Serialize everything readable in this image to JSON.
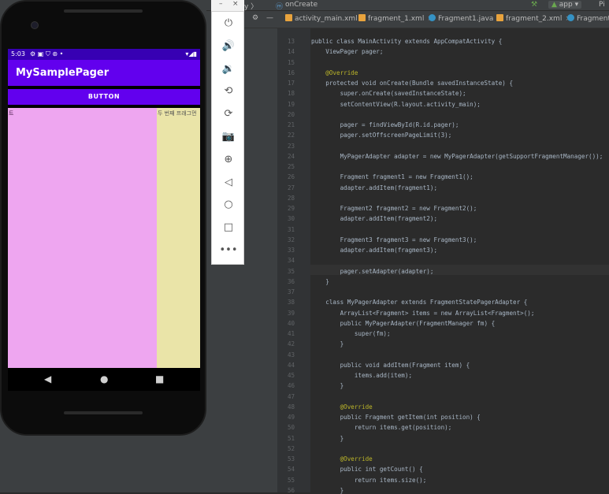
{
  "ide": {
    "breadcrumb_sep": "y 〉",
    "breadcrumb_method": "onCreate",
    "run_config": "app",
    "run_config_extra": "Pi",
    "tabs": [
      {
        "label": "activity_main.xml",
        "color": "#e8a33d"
      },
      {
        "label": "fragment_1.xml",
        "color": "#e8a33d"
      },
      {
        "label": "Fragment1.java",
        "color": "#3592c4"
      },
      {
        "label": "fragment_2.xml",
        "color": "#e8a33d"
      },
      {
        "label": "Fragment2.j",
        "color": "#3592c4"
      }
    ],
    "tab_close": "×"
  },
  "emulator_toolbar": {
    "minimize": "–",
    "close": "×",
    "icons": [
      "power-icon",
      "volume-up-icon",
      "volume-down-icon",
      "rotate-left-icon",
      "rotate-right-icon",
      "camera-icon",
      "zoom-icon",
      "back-icon",
      "home-icon",
      "overview-icon",
      "more-icon"
    ],
    "glyphs": [
      "⏻",
      "🔊",
      "🔉",
      "⟲",
      "⟳",
      "📷",
      "⊕",
      "◁",
      "○",
      "□",
      "•••"
    ]
  },
  "phone": {
    "time": "5:03",
    "status_icons": "⚙ ▣ ⛉ ⊛ •",
    "right_icons": "▾◢▮",
    "app_title": "MySamplePager",
    "button_label": "BUTTON",
    "page1_text": "트",
    "page2_text": "두 번째 프래그먼",
    "nav_back": "◀",
    "nav_home": "●",
    "nav_recent": "■"
  },
  "code_lines": [
    {
      "n": "13",
      "t": "public class MainActivity extends AppCompatActivity {"
    },
    {
      "n": "14",
      "t": "    ViewPager pager;"
    },
    {
      "n": "15",
      "t": ""
    },
    {
      "n": "16",
      "t": "    @Override"
    },
    {
      "n": "17",
      "t": "    protected void onCreate(Bundle savedInstanceState) {"
    },
    {
      "n": "18",
      "t": "        super.onCreate(savedInstanceState);"
    },
    {
      "n": "19",
      "t": "        setContentView(R.layout.activity_main);"
    },
    {
      "n": "20",
      "t": ""
    },
    {
      "n": "21",
      "t": "        pager = findViewById(R.id.pager);"
    },
    {
      "n": "22",
      "t": "        pager.setOffscreenPageLimit(3);"
    },
    {
      "n": "23",
      "t": ""
    },
    {
      "n": "24",
      "t": "        MyPagerAdapter adapter = new MyPagerAdapter(getSupportFragmentManager());"
    },
    {
      "n": "25",
      "t": ""
    },
    {
      "n": "26",
      "t": "        Fragment fragment1 = new Fragment1();"
    },
    {
      "n": "27",
      "t": "        adapter.addItem(fragment1);"
    },
    {
      "n": "28",
      "t": ""
    },
    {
      "n": "29",
      "t": "        Fragment2 fragment2 = new Fragment2();"
    },
    {
      "n": "30",
      "t": "        adapter.addItem(fragment2);"
    },
    {
      "n": "31",
      "t": ""
    },
    {
      "n": "32",
      "t": "        Fragment3 fragment3 = new Fragment3();"
    },
    {
      "n": "33",
      "t": "        adapter.addItem(fragment3);"
    },
    {
      "n": "34",
      "t": ""
    },
    {
      "n": "35",
      "t": "        pager.setAdapter(adapter);"
    },
    {
      "n": "36",
      "t": "    }"
    },
    {
      "n": "37",
      "t": ""
    },
    {
      "n": "38",
      "t": "    class MyPagerAdapter extends FragmentStatePagerAdapter {"
    },
    {
      "n": "39",
      "t": "        ArrayList<Fragment> items = new ArrayList<Fragment>();"
    },
    {
      "n": "40",
      "t": "        public MyPagerAdapter(FragmentManager fm) {"
    },
    {
      "n": "41",
      "t": "            super(fm);"
    },
    {
      "n": "42",
      "t": "        }"
    },
    {
      "n": "43",
      "t": ""
    },
    {
      "n": "44",
      "t": "        public void addItem(Fragment item) {"
    },
    {
      "n": "45",
      "t": "            items.add(item);"
    },
    {
      "n": "46",
      "t": "        }"
    },
    {
      "n": "47",
      "t": ""
    },
    {
      "n": "48",
      "t": "        @Override"
    },
    {
      "n": "49",
      "t": "        public Fragment getItem(int position) {"
    },
    {
      "n": "50",
      "t": "            return items.get(position);"
    },
    {
      "n": "51",
      "t": "        }"
    },
    {
      "n": "52",
      "t": ""
    },
    {
      "n": "53",
      "t": "        @Override"
    },
    {
      "n": "54",
      "t": "        public int getCount() {"
    },
    {
      "n": "55",
      "t": "            return items.size();"
    },
    {
      "n": "56",
      "t": "        }"
    }
  ]
}
